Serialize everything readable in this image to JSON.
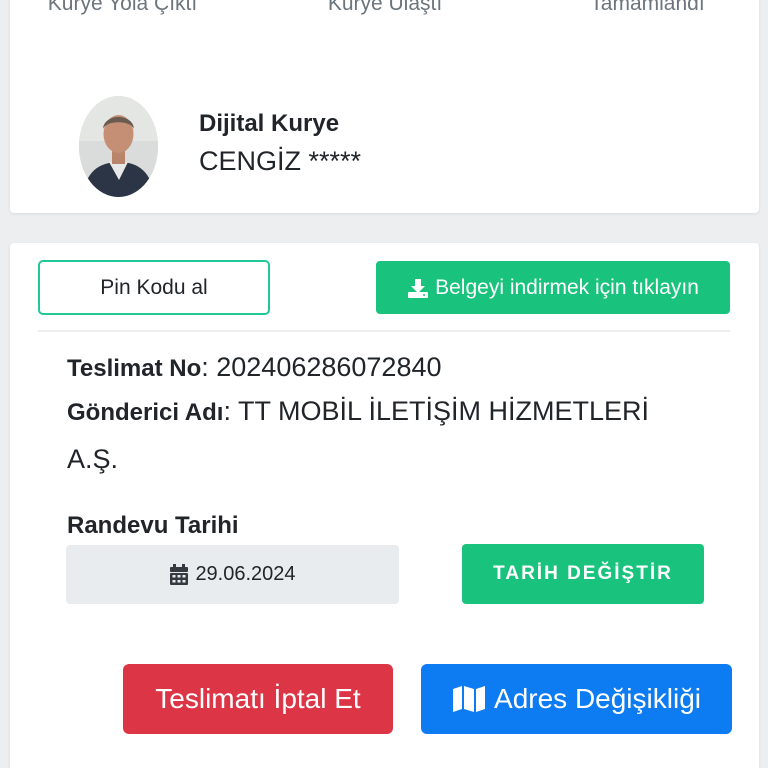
{
  "progress_steps": [
    {
      "label": "Kurye Yola Çıktı"
    },
    {
      "label": "Kurye Ulaştı"
    },
    {
      "label": "Tamamlandı"
    }
  ],
  "courier": {
    "role": "Dijital Kurye",
    "name": "CENGİZ *****"
  },
  "actions": {
    "pin_label": "Pin Kodu al",
    "download_label": "Belgeyi indirmek için tıklayın"
  },
  "delivery": {
    "no_label": "Teslimat No",
    "no_value": ": 202406286072840",
    "sender_label": "Gönderici Adı",
    "sender_value_line1": ": TT MOBİL İLETİŞİM HİZMETLERİ",
    "sender_value_line2": "A.Ş."
  },
  "appointment": {
    "label": "Randevu Tarihi",
    "date": "29.06.2024",
    "change_label": "TARİH DEĞİŞTİR"
  },
  "footer_actions": {
    "cancel_label": "Teslimatı İptal Et",
    "address_label": "Adres Değişikliği"
  },
  "colors": {
    "green": "#19c37d",
    "red": "#dc3545",
    "blue": "#0d7cf2"
  },
  "icons": [
    "download-icon",
    "calendar-icon",
    "map-icon"
  ]
}
